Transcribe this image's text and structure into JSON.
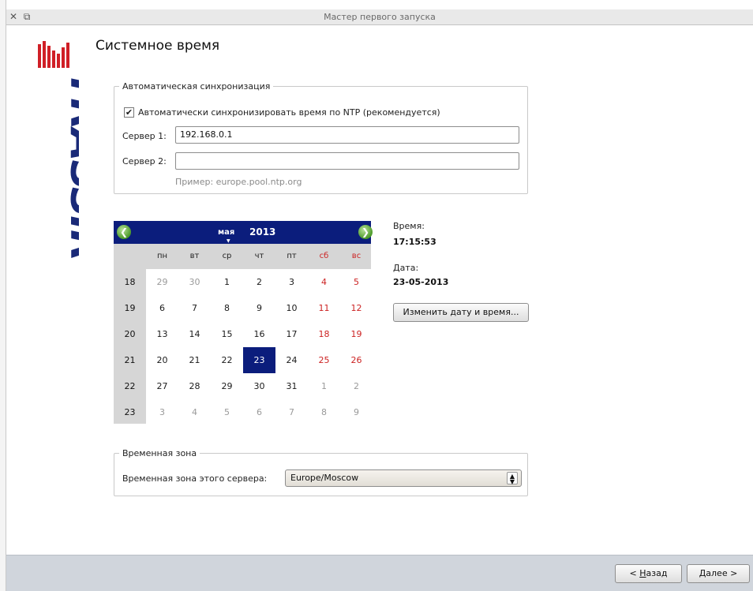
{
  "window": {
    "title": "Мастер первого запуска",
    "wm_icons": "✕ ⧉"
  },
  "page": {
    "title": "Системное время"
  },
  "auto_sync": {
    "legend": "Автоматическая синхронизация",
    "checkbox_label": "Автоматически синхронизировать время по NTP (рекомендуется)",
    "checked": true,
    "server1_label": "Сервер 1:",
    "server1_value": "192.168.0.1",
    "server2_label": "Сервер 2:",
    "server2_value": "",
    "example_hint": "Пример: europe.pool.ntp.org"
  },
  "calendar": {
    "month": "мая",
    "year": "2013",
    "weekdays": [
      "пн",
      "вт",
      "ср",
      "чт",
      "пт",
      "сб",
      "вс"
    ],
    "weeks": [
      {
        "num": "18",
        "days": [
          "29",
          "30",
          "1",
          "2",
          "3",
          "4",
          "5"
        ]
      },
      {
        "num": "19",
        "days": [
          "6",
          "7",
          "8",
          "9",
          "10",
          "11",
          "12"
        ]
      },
      {
        "num": "20",
        "days": [
          "13",
          "14",
          "15",
          "16",
          "17",
          "18",
          "19"
        ]
      },
      {
        "num": "21",
        "days": [
          "20",
          "21",
          "22",
          "23",
          "24",
          "25",
          "26"
        ]
      },
      {
        "num": "22",
        "days": [
          "27",
          "28",
          "29",
          "30",
          "31",
          "1",
          "2"
        ]
      },
      {
        "num": "23",
        "days": [
          "3",
          "4",
          "5",
          "6",
          "7",
          "8",
          "9"
        ]
      }
    ],
    "selected_day": "23",
    "colors": {
      "header": "#0b1d7c",
      "weekend": "#cc2222",
      "nav": "#4b9a28"
    }
  },
  "time_info": {
    "time_label": "Время:",
    "time_value": "17:15:53",
    "date_label": "Дата:",
    "date_value": "23-05-2013",
    "change_button": "Изменить дату и время..."
  },
  "timezone": {
    "legend": "Временная зона",
    "label": "Временная зона этого сервера:",
    "value": "Europe/Moscow"
  },
  "footer": {
    "back_underlined": "Н",
    "back_rest": "азад",
    "back_prefix": "< ",
    "next_underlined": "Д",
    "next_rest": "алее",
    "next_suffix": " >"
  },
  "logo": {
    "text": "TRASSIR",
    "color": "#1a2a78",
    "accent": "#d01f26"
  }
}
